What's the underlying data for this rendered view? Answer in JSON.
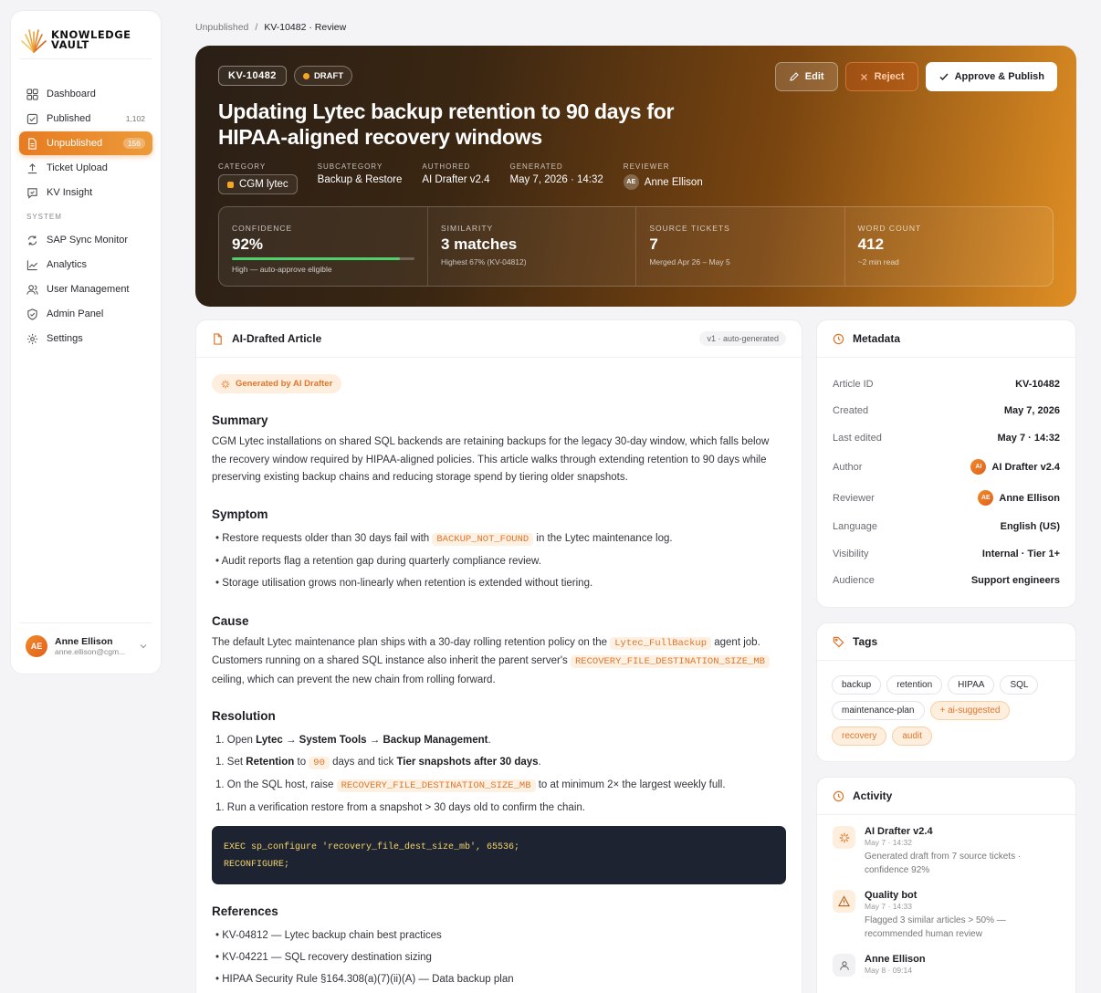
{
  "brand": {
    "line1": "KNOWLEDGE",
    "line2": "VAULT"
  },
  "nav": {
    "items": [
      {
        "label": "Dashboard",
        "count": ""
      },
      {
        "label": "Published",
        "count": "1,102"
      },
      {
        "label": "Unpublished",
        "count": "156"
      },
      {
        "label": "Ticket Upload",
        "count": ""
      },
      {
        "label": "KV Insight",
        "count": ""
      }
    ],
    "section": "SYSTEM",
    "system_items": [
      {
        "label": "SAP Sync Monitor"
      },
      {
        "label": "Analytics"
      },
      {
        "label": "User Management"
      },
      {
        "label": "Admin Panel"
      },
      {
        "label": "Settings"
      }
    ]
  },
  "user": {
    "initials": "AE",
    "name": "Anne Ellison",
    "email": "anne.ellison@cgm..."
  },
  "breadcrumb": {
    "parent": "Unpublished",
    "sep": "/",
    "current": "KV-10482 · Review"
  },
  "hero": {
    "id": "KV-10482",
    "status": "DRAFT",
    "title": "Updating Lytec backup retention to 90 days for HIPAA-aligned recovery windows",
    "actions": {
      "edit": "Edit",
      "reject": "Reject",
      "approve": "Approve & Publish"
    },
    "meta": {
      "category_label": "CATEGORY",
      "category": "CGM lytec",
      "subcategory_label": "SUBCATEGORY",
      "subcategory": "Backup & Restore",
      "authored_label": "AUTHORED",
      "authored": "AI Drafter v2.4",
      "generated_label": "GENERATED",
      "generated": "May 7, 2026 · 14:32",
      "reviewer_label": "REVIEWER",
      "reviewer_initials": "AE",
      "reviewer": "Anne Ellison"
    },
    "stats": [
      {
        "label": "CONFIDENCE",
        "value": "92%",
        "sub": "High — auto-approve eligible",
        "progress": 0.92
      },
      {
        "label": "SIMILARITY",
        "value": "3 matches",
        "sub": "Highest 67% (KV-04812)"
      },
      {
        "label": "SOURCE TICKETS",
        "value": "7",
        "sub": "Merged Apr 26 – May 5"
      },
      {
        "label": "WORD COUNT",
        "value": "412",
        "sub": "~2 min read"
      }
    ]
  },
  "article": {
    "title": "AI-Drafted Article",
    "version": "v1 · auto-generated",
    "generated_by": "Generated by AI Drafter",
    "summary_h": "Summary",
    "summary": "CGM Lytec installations on shared SQL backends are retaining backups for the legacy 30-day window, which falls below the recovery window required by HIPAA-aligned policies. This article walks through extending retention to 90 days while preserving existing backup chains and reducing storage spend by tiering older snapshots.",
    "symptom_h": "Symptom",
    "symptom_1a": "Restore requests older than 30 days fail with",
    "symptom_1code": "BACKUP_NOT_FOUND",
    "symptom_1b": "in the Lytec maintenance log.",
    "symptom_2": "Audit reports flag a retention gap during quarterly compliance review.",
    "symptom_3": "Storage utilisation grows non-linearly when retention is extended without tiering.",
    "cause_h": "Cause",
    "cause_a": "The default Lytec maintenance plan ships with a 30-day rolling retention policy on the",
    "cause_code1": "Lytec_FullBackup",
    "cause_b": "agent job. Customers running on a shared SQL instance also inherit the parent server's",
    "cause_code2": "RECOVERY_FILE_DESTINATION_SIZE_MB",
    "cause_c": "ceiling, which can prevent the new chain from rolling forward.",
    "resolution_h": "Resolution",
    "res_num": "1.",
    "res1_a": "Open",
    "res1_b": "Lytec → System Tools → Backup Management",
    "res1_c": ".",
    "res2_a": "Set",
    "res2_b": "Retention",
    "res2_c": "to",
    "res2_code": "90",
    "res2_d": "days and tick",
    "res2_e": "Tier snapshots after 30 days",
    "res2_f": ".",
    "res3_a": "On the SQL host, raise",
    "res3_code": "RECOVERY_FILE_DESTINATION_SIZE_MB",
    "res3_b": "to at minimum 2× the largest weekly full.",
    "res4": "Run a verification restore from a snapshot > 30 days old to confirm the chain.",
    "code_line1": "EXEC sp_configure 'recovery_file_dest_size_mb', 65536;",
    "code_line2": "RECONFIGURE;",
    "references_h": "References",
    "ref1": "KV-04812 — Lytec backup chain best practices",
    "ref2": "KV-04221 — SQL recovery destination sizing",
    "ref3": "HIPAA Security Rule §164.308(a)(7)(ii)(A) — Data backup plan"
  },
  "metadata": {
    "title": "Metadata",
    "rows": [
      {
        "label": "Article ID",
        "value": "KV-10482"
      },
      {
        "label": "Created",
        "value": "May 7, 2026"
      },
      {
        "label": "Last edited",
        "value": "May 7 · 14:32"
      },
      {
        "label": "Author",
        "value": "AI Drafter v2.4",
        "avatar": "AI"
      },
      {
        "label": "Reviewer",
        "value": "Anne Ellison",
        "avatar": "AE"
      },
      {
        "label": "Language",
        "value": "English (US)"
      },
      {
        "label": "Visibility",
        "value": "Internal · Tier 1+"
      },
      {
        "label": "Audience",
        "value": "Support engineers"
      }
    ]
  },
  "tags": {
    "title": "Tags",
    "items": [
      "backup",
      "retention",
      "HIPAA",
      "SQL",
      "maintenance-plan",
      "+ ai-suggested",
      "recovery",
      "audit"
    ]
  },
  "activity": {
    "title": "Activity",
    "items": [
      {
        "name": "AI Drafter v2.4",
        "time": "May 7 · 14:32",
        "desc": "Generated draft from 7 source tickets · confidence 92%"
      },
      {
        "name": "Quality bot",
        "time": "May 7 · 14:33",
        "desc": "Flagged 3 similar articles > 50% — recommended human review"
      },
      {
        "name": "Anne Ellison",
        "time": "May 8 · 09:14",
        "desc": ""
      }
    ]
  },
  "colors": {
    "accent": "#e77c22",
    "hero_dark": "#2a1f16",
    "hero_light": "#e08f24",
    "success": "#4fd06a"
  }
}
